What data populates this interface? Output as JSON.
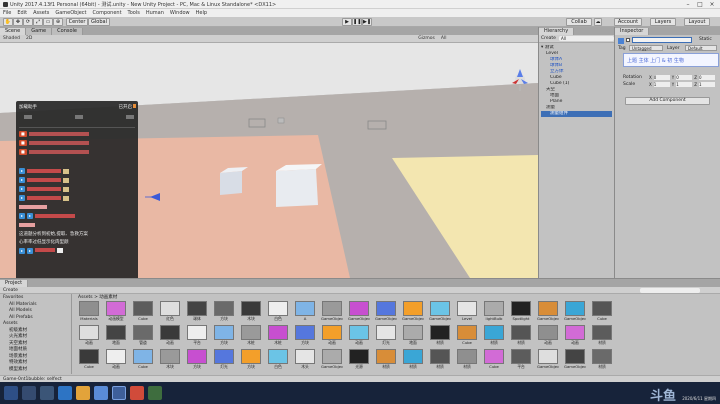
{
  "window": {
    "title": "Unity 2017.4.13f1 Personal (64bit) - 测试.unity - New Unity Project - PC, Mac & Linux Standalone* <DX11>"
  },
  "menu": [
    "File",
    "Edit",
    "Assets",
    "GameObject",
    "Component",
    "Tools",
    "Human",
    "Window",
    "Help"
  ],
  "toolbar": {
    "center": "Center",
    "global": "Global",
    "collab": "Collab",
    "account": "Account",
    "layers": "Layers",
    "layout": "Layout"
  },
  "scene": {
    "tabs": [
      "Scene",
      "Game",
      "Console"
    ],
    "sub": [
      "Shaded",
      "2D",
      "Gizmos",
      "All"
    ]
  },
  "overlay": {
    "title": "加载助手",
    "corner": "已开启",
    "line_warning": "这道题分析到初始,提取、急救方案",
    "line_warning2": "心率率过低显示化肉型颜"
  },
  "hierarchy": {
    "title": "Hierarchy",
    "create": "Create",
    "search_placeholder": "All",
    "scene_name": "测试",
    "items": [
      "Level",
      "球体A",
      "球体B",
      "立方体",
      "Cube",
      "Cube (1)",
      "天空",
      "地面",
      "Plane",
      "测量",
      "测量组件"
    ]
  },
  "inspector": {
    "title": "Inspector",
    "static": "Static",
    "tag_label": "Tag",
    "tag": "Untagged",
    "layer_label": "Layer",
    "layer": "Default",
    "handwriting": "上题 主体 上门 & 初 生物",
    "rotation": "Rotation",
    "scale": "Scale",
    "x": "X",
    "y": "Y",
    "z": "Z",
    "val0": "0",
    "val1": "1",
    "add_component": "Add Component"
  },
  "project": {
    "title": "Project",
    "create": "Create",
    "breadcrumb": "Assets > 动画素材",
    "tree": [
      "Favorites",
      "All Materials",
      "All Models",
      "All Prefabs",
      "Assets",
      "初级素材",
      "火光素材",
      "天空素材",
      "地面材质",
      "场景素材",
      "特效素材",
      "模型素材",
      "动画素材",
      "音效素材",
      "Packages"
    ],
    "row1": [
      "Materials",
      "动画模型",
      "Cube",
      "红色",
      "球体",
      "方块",
      "木块",
      "白色",
      "A",
      "GameObject",
      "GameObject",
      "GameObject",
      "GameObject",
      "GameObject",
      "Level",
      "lightBulb",
      "Spotlight",
      "GameObject",
      "GameObject",
      "Cube"
    ],
    "row2": [
      "动画",
      "地面",
      "管道",
      "动画",
      "平台",
      "方块",
      "木桩",
      "木桩",
      "方块",
      "动画",
      "动画",
      "灯光",
      "地面",
      "材质",
      "Cube",
      "材质",
      "材质",
      "动画",
      "动画",
      "材质"
    ],
    "row3": [
      "Cube",
      "动画",
      "Cube",
      "木块",
      "方块",
      "灯光",
      "方块",
      "白色",
      "木头",
      "GameObject",
      "光源",
      "材质",
      "材质",
      "材质",
      "材质",
      "Cube",
      "平台",
      "GameObject",
      "GameObject",
      "材质"
    ],
    "status": "Game-0nt1bubble: selfect"
  },
  "taskbar": {
    "date": "2020/6/11 星期四",
    "time": "",
    "watermark": "斗鱼"
  }
}
